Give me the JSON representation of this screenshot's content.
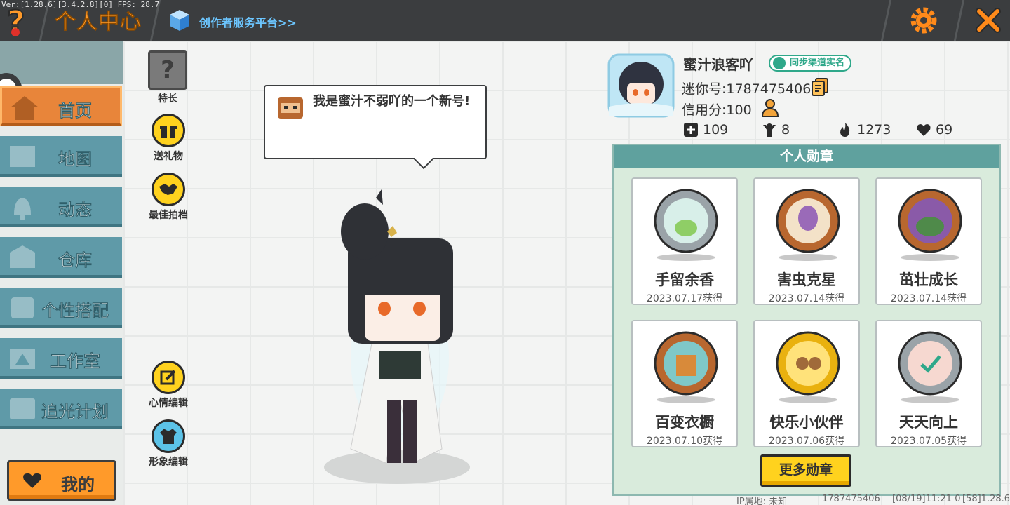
{
  "header": {
    "version_text": "Ver:[1.28.6][3.4.2.8][0] FPS: 28.7",
    "title": "个人中心",
    "creator_link": "创作者服务平台>>"
  },
  "sidebar": {
    "items": [
      {
        "label": "首页",
        "icon": "house-icon",
        "active": true
      },
      {
        "label": "地图",
        "icon": "map-icon",
        "active": false
      },
      {
        "label": "动态",
        "icon": "bell-icon",
        "active": false
      },
      {
        "label": "仓库",
        "icon": "box-icon",
        "active": false
      },
      {
        "label": "个性搭配",
        "icon": "outfit-icon",
        "active": false
      },
      {
        "label": "工作室",
        "icon": "studio-icon",
        "active": false
      },
      {
        "label": "追光计划",
        "icon": "star-plan-icon",
        "active": false
      }
    ],
    "mine_button": "我的"
  },
  "actions": {
    "specialty": "特长",
    "send_gift": "送礼物",
    "best_partner": "最佳拍档",
    "mood_edit": "心情编辑",
    "image_edit": "形象编辑"
  },
  "bubble": {
    "text": "我是蜜汁不弱吖的一个新号!"
  },
  "profile": {
    "nickname": "蜜汁浪客吖",
    "sync_badge": "同步渠道实名",
    "mini_id": "迷你号:1787475406",
    "credit": "信用分:100",
    "stats": {
      "add": "109",
      "fans": "8",
      "popularity": "1273",
      "likes": "69"
    }
  },
  "medals": {
    "title": "个人勋章",
    "items": [
      {
        "name": "手留余香",
        "date": "2023.07.17获得",
        "rim": "#9aa3a8"
      },
      {
        "name": "害虫克星",
        "date": "2023.07.14获得",
        "rim": "#b8672f"
      },
      {
        "name": "茁壮成长",
        "date": "2023.07.14获得",
        "rim": "#b8672f"
      },
      {
        "name": "百变衣橱",
        "date": "2023.07.10获得",
        "rim": "#b8672f"
      },
      {
        "name": "快乐小伙伴",
        "date": "2023.07.06获得",
        "rim": "#e9b10f"
      },
      {
        "name": "天天向上",
        "date": "2023.07.05获得",
        "rim": "#9aa3a8"
      }
    ],
    "more_button": "更多勋章"
  },
  "footer": {
    "ip": "IP属地: 未知",
    "uid": "1787475406",
    "time": "[08/19]11:21 0",
    "build": "[58]1.28.6"
  },
  "colors": {
    "accent_orange": "#ff9a2a",
    "nav_teal": "#5f9aa8",
    "panel_green": "#d9ebdc",
    "button_yellow": "#ffd21e"
  }
}
